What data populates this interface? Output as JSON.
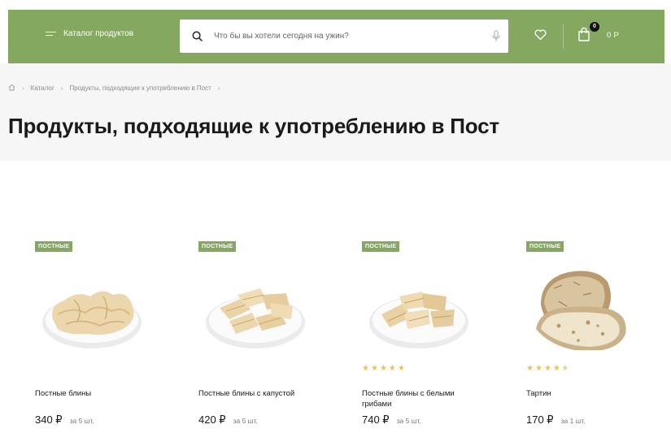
{
  "header": {
    "catalog_label": "Каталог продуктов",
    "search_placeholder": "Что бы вы хотели сегодня на ужин?",
    "cart_count": "0",
    "cart_total": "0 Р"
  },
  "breadcrumb": [
    "Каталог",
    "Продукты, подходящие к употреблению в Пост"
  ],
  "page_title": "Продукты, подходящие к употреблению в Пост",
  "colors": {
    "accent": "#84a860",
    "star": "#e8c35a"
  },
  "products": [
    {
      "badge": "ПОСТНЫЕ",
      "name": "Постные блины",
      "price": "340 ₽",
      "unit": "за 5 шт.",
      "rating": 0
    },
    {
      "badge": "ПОСТНЫЕ",
      "name": "Постные блины с капустой",
      "price": "420 ₽",
      "unit": "за 5 шт.",
      "rating": 0
    },
    {
      "badge": "ПОСТНЫЕ",
      "name": "Постные блины с белыми грибами",
      "price": "740 ₽",
      "unit": "за 5 шт.",
      "rating": 5
    },
    {
      "badge": "ПОСТНЫЕ",
      "name": "Тартин",
      "price": "170 ₽",
      "unit": "за 1 шт.",
      "rating": 4.5
    }
  ]
}
